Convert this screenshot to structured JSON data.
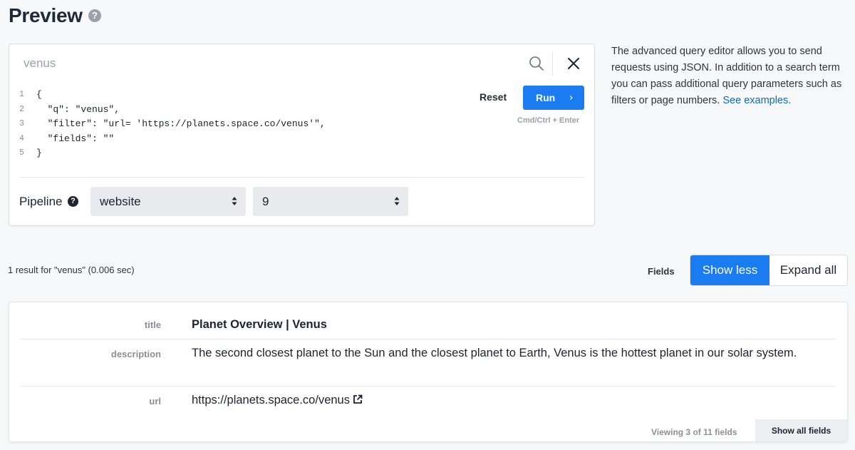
{
  "header": {
    "title": "Preview",
    "help_icon": "question-circle-icon",
    "help_glyph": "?"
  },
  "query": {
    "search_value": "venus",
    "code_lines": [
      {
        "num": "1",
        "text": "{"
      },
      {
        "num": "2",
        "text": "  \"q\": \"venus\","
      },
      {
        "num": "3",
        "text": "  \"filter\": \"url= 'https://planets.space.co/venus'\","
      },
      {
        "num": "4",
        "text": "  \"fields\": \"\""
      },
      {
        "num": "5",
        "text": "}"
      }
    ],
    "reset_label": "Reset",
    "run_label": "Run",
    "run_chevron": "›",
    "shortcut_hint": "Cmd/Ctrl + Enter",
    "pipeline_label": "Pipeline",
    "pipeline_help_glyph": "?",
    "pipeline_select": "website",
    "count_select": "9"
  },
  "help_text": {
    "body": "The advanced query editor allows you to send requests using JSON. In addition to a search term you can pass additional query parameters such as filters or page numbers.",
    "link": "See examples."
  },
  "results": {
    "summary": "1 result for \"venus\" (0.006 sec)",
    "fields_label": "Fields",
    "show_less_label": "Show less",
    "expand_all_label": "Expand all"
  },
  "result_card": {
    "fields": [
      {
        "name": "title",
        "value": "Planet Overview | Venus"
      },
      {
        "name": "description",
        "value": "The second closest planet to the Sun and the closest planet to Earth, Venus is the hottest planet in our solar system."
      },
      {
        "name": "url",
        "value": "https://planets.space.co/venus"
      }
    ],
    "viewing_text": "Viewing 3 of 11 fields",
    "show_all_label": "Show all fields"
  },
  "colors": {
    "accent": "#1b7cf2",
    "link": "#0a6bcc",
    "background": "#f7f8fa"
  }
}
